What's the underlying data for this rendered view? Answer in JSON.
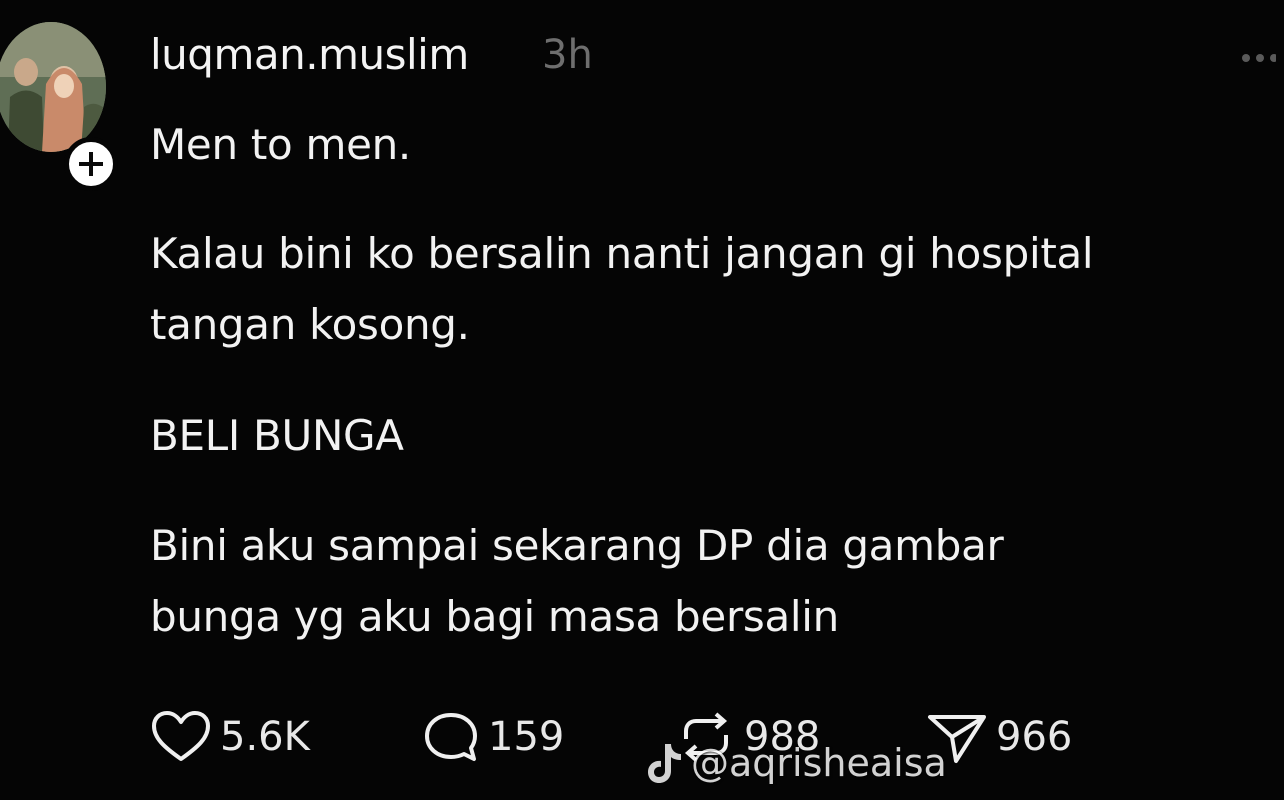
{
  "post": {
    "author": {
      "username": "luqman.muslim",
      "time_ago": "3h",
      "avatar_icon": "avatar-photo",
      "follow_icon": "plus-icon"
    },
    "text": {
      "p1": [
        "Men to men."
      ],
      "p2": [
        "Kalau bini ko bersalin nanti jangan gi hospital",
        "tangan kosong."
      ],
      "p3": [
        "BELI BUNGA"
      ],
      "p4": [
        "Bini aku sampai sekarang DP dia gambar",
        "bunga yg aku bagi masa bersalin"
      ]
    },
    "actions": {
      "likes": "5.6K",
      "replies": "159",
      "reposts": "988",
      "shares": "966"
    }
  },
  "watermark": {
    "logo_icon": "tiktok-logo",
    "handle": "@aqrisheaisa"
  },
  "colors": {
    "background": "#050505",
    "text": "#f2f2f2",
    "muted": "#6e6e6e"
  }
}
